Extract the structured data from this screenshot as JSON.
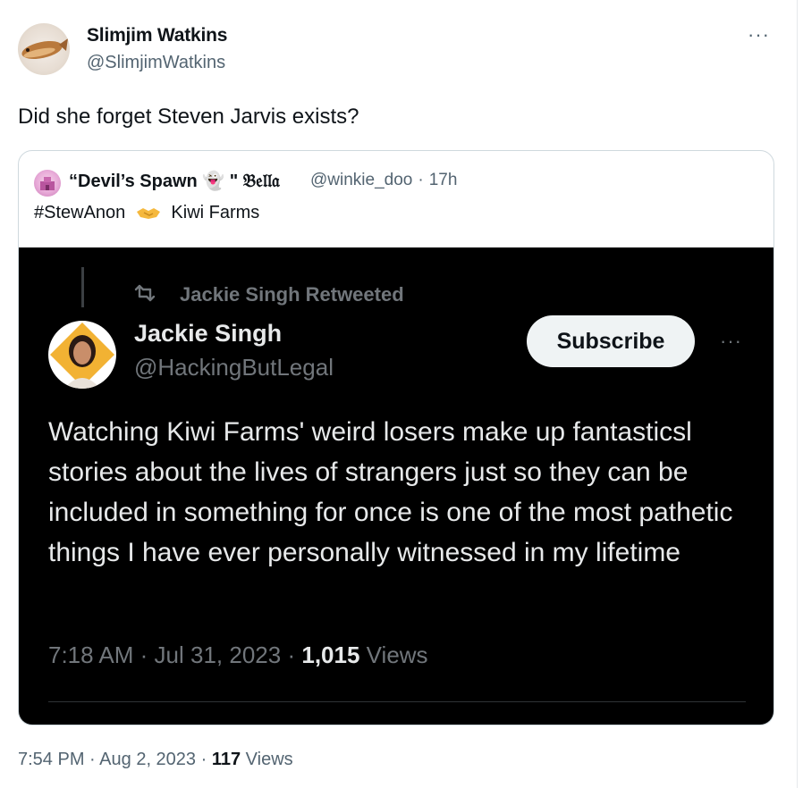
{
  "tweet": {
    "author_name": "Slimjim Watkins",
    "author_handle": "@SlimjimWatkins",
    "more_label": "···",
    "text": "Did she forget Steven Jarvis exists?",
    "time": "7:54 PM",
    "date": "Aug 2, 2023",
    "views_count": "117",
    "views_label": "Views",
    "sep": "·"
  },
  "quote": {
    "name": "“Devil’s Spawn 👻 \" 𝔅𝔢𝔩𝔩𝔞",
    "handle": "@winkie_doo",
    "sep": "·",
    "age": "17h",
    "text_tag": "#StewAnon",
    "text_rest": "Kiwi Farms",
    "handshake_emoji": "🤝"
  },
  "screenshot": {
    "retweet_label": "Jackie Singh Retweeted",
    "name": "Jackie Singh",
    "handle": "@HackingButLegal",
    "subscribe_label": "Subscribe",
    "more_label": "···",
    "body": "Watching Kiwi Farms' weird losers make up fantasticsl stories about the lives of strangers just so they can be included in something for once is one of the most pathetic things I have ever personally witnessed in my lifetime",
    "time": "7:18 AM",
    "date": "Jul 31, 2023",
    "views_count": "1,015",
    "views_label": "Views",
    "sep": "·"
  },
  "colors": {
    "text_primary": "#0f1419",
    "text_secondary": "#536471",
    "dark_bg": "#000000",
    "dark_text": "#e7e9ea",
    "dark_secondary": "#71767b"
  }
}
